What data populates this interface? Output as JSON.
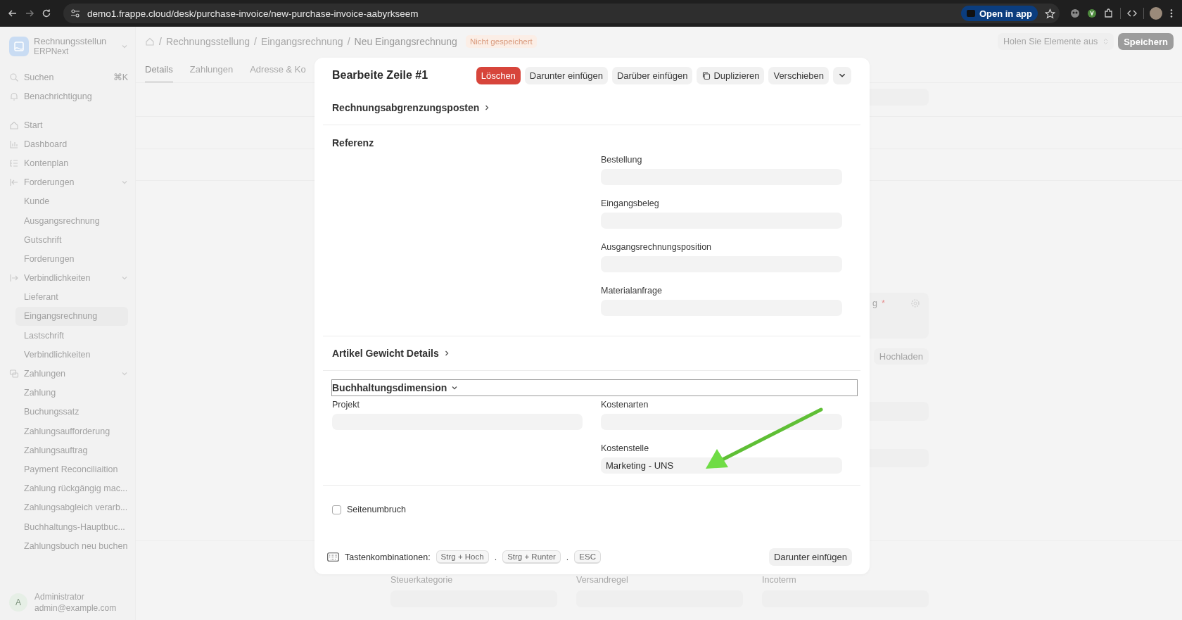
{
  "browser": {
    "url": "demo1.frappe.cloud/desk/purchase-invoice/new-purchase-invoice-aabyrkseem",
    "open_in_app": "Open in app"
  },
  "sidebar": {
    "app_title": "Rechnungsstellun",
    "app_subtitle": "ERPNext",
    "search": {
      "label": "Suchen",
      "shortcut": "⌘K"
    },
    "notifications": "Benachrichtigung",
    "items": [
      {
        "label": "Start",
        "selected": false
      },
      {
        "label": "Dashboard",
        "selected": false
      },
      {
        "label": "Kontenplan",
        "selected": false
      },
      {
        "label": "Forderungen",
        "selected": false,
        "expanded": true,
        "children": [
          {
            "label": "Kunde",
            "selected": false
          },
          {
            "label": "Ausgangsrechnung",
            "selected": false
          },
          {
            "label": "Gutschrift",
            "selected": false
          },
          {
            "label": "Forderungen",
            "selected": false
          }
        ]
      },
      {
        "label": "Verbindlichkeiten",
        "selected": false,
        "expanded": true,
        "children": [
          {
            "label": "Lieferant",
            "selected": false
          },
          {
            "label": "Eingangsrechnung",
            "selected": true
          },
          {
            "label": "Lastschrift",
            "selected": false
          },
          {
            "label": "Verbindlichkeiten",
            "selected": false
          }
        ]
      },
      {
        "label": "Zahlungen",
        "selected": false,
        "expanded": true,
        "children": [
          {
            "label": "Zahlung",
            "selected": false
          },
          {
            "label": "Buchungssatz",
            "selected": false
          },
          {
            "label": "Zahlungsaufforderung",
            "selected": false
          },
          {
            "label": "Zahlungsauftrag",
            "selected": false
          },
          {
            "label": "Payment Reconciliaition",
            "selected": false
          },
          {
            "label": "Zahlung rückgängig mac...",
            "selected": false
          },
          {
            "label": "Zahlungsabgleich verarb...",
            "selected": false
          },
          {
            "label": "Buchhaltungs-Hauptbuc...",
            "selected": false
          },
          {
            "label": "Zahlungsbuch neu buchen",
            "selected": false
          }
        ]
      }
    ],
    "user": {
      "initial": "A",
      "name": "Administrator",
      "email": "admin@example.com"
    }
  },
  "page": {
    "breadcrumb_separator": "/",
    "breadcrumbs": [
      "Rechnungsstellung",
      "Eingangsrechnung",
      "Neu Eingangsrechnung"
    ],
    "status": "Nicht gespeichert",
    "get_items": "Holen Sie Elemente aus",
    "save": "Speichern",
    "tabs": [
      {
        "label": "Details",
        "selected": true
      },
      {
        "label": "Zahlungen",
        "selected": false
      },
      {
        "label": "Adresse & Ko",
        "selected": false
      }
    ],
    "partial_label": "g",
    "partial_required_mark": "*",
    "upload": "Hochladen",
    "bottom_labels": [
      "Steuerkategorie",
      "Versandregel",
      "Incoterm"
    ]
  },
  "dialog": {
    "title": "Bearbeite Zeile #1",
    "actions": [
      {
        "kind": "danger",
        "label": "Löschen"
      },
      {
        "kind": "plain",
        "label": "Darunter einfügen"
      },
      {
        "kind": "plain",
        "label": "Darüber einfügen"
      },
      {
        "kind": "copy",
        "label": "Duplizieren"
      },
      {
        "kind": "plain",
        "label": "Verschieben"
      },
      {
        "kind": "menu"
      }
    ],
    "sections": [
      {
        "kind": "heading",
        "title": "Rechnungsabgrenzungsposten",
        "expanded": false,
        "focused": false
      },
      {
        "kind": "fields",
        "title": "Referenz",
        "right": [
          {
            "label": "Bestellung"
          },
          {
            "label": "Eingangsbeleg"
          },
          {
            "label": "Ausgangsrechnungsposition"
          },
          {
            "label": "Materialanfrage"
          }
        ]
      },
      {
        "kind": "heading",
        "title": "Artikel Gewicht Details",
        "expanded": false,
        "focused": false
      },
      {
        "kind": "heading",
        "title": "Buchhaltungsdimension",
        "expanded": true,
        "focused": true,
        "left": [
          {
            "label": "Projekt"
          }
        ],
        "right": [
          {
            "label": "Kostenarten"
          },
          {
            "label": "Kostenstelle",
            "value": "Marketing - UNS"
          }
        ]
      },
      {
        "kind": "checks",
        "items": [
          {
            "label": "Seitenumbruch",
            "checked": false
          }
        ]
      }
    ],
    "shortcuts": {
      "label": "Tastenkombinationen:",
      "keys": [
        "Strg + Hoch",
        "Strg + Runter",
        "ESC"
      ],
      "separator": "."
    },
    "footer_button": "Darunter einfügen"
  }
}
